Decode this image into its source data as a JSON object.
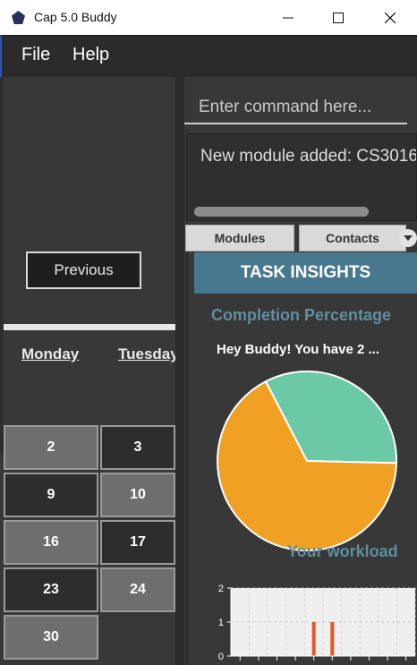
{
  "window": {
    "title": "Cap 5.0 Buddy",
    "controls": {
      "minimize": "—",
      "maximize": "☐",
      "close": "✕"
    }
  },
  "menu": {
    "file": "File",
    "help": "Help"
  },
  "calendar": {
    "previous_label": "Previous",
    "days": [
      "Monday",
      "Tuesday"
    ],
    "cells": [
      {
        "day": "2",
        "shade": "light"
      },
      {
        "day": "3",
        "shade": "dark"
      },
      {
        "day": "9",
        "shade": "dark"
      },
      {
        "day": "10",
        "shade": "light"
      },
      {
        "day": "16",
        "shade": "light"
      },
      {
        "day": "17",
        "shade": "dark"
      },
      {
        "day": "23",
        "shade": "dark"
      },
      {
        "day": "24",
        "shade": "light"
      },
      {
        "day": "30",
        "shade": "light"
      }
    ]
  },
  "command": {
    "placeholder": "Enter command here...",
    "result": "New module added: CS3016"
  },
  "tabs": {
    "modules": "Modules",
    "contacts": "Contacts"
  },
  "insights": {
    "header": "TASK INSIGHTS",
    "completion_label": "Completion Percentage",
    "greeting": "Hey Buddy! You have 2 ...",
    "workload_label": "Your workload"
  },
  "colors": {
    "pie_complete": "#6cc9a5",
    "pie_incomplete": "#f0a022",
    "bar": "#e8552b",
    "accent": "#47788d"
  },
  "chart_data": [
    {
      "type": "pie",
      "title": "Completion Percentage",
      "slices": [
        {
          "value": 33
        },
        {
          "value": 67
        }
      ]
    },
    {
      "type": "bar",
      "title": "Your workload",
      "ylim": [
        0,
        2
      ],
      "yticks": [
        "0",
        "1",
        "2"
      ],
      "values": [
        0,
        0,
        0,
        0,
        1,
        1,
        0,
        0,
        0,
        0
      ]
    }
  ]
}
